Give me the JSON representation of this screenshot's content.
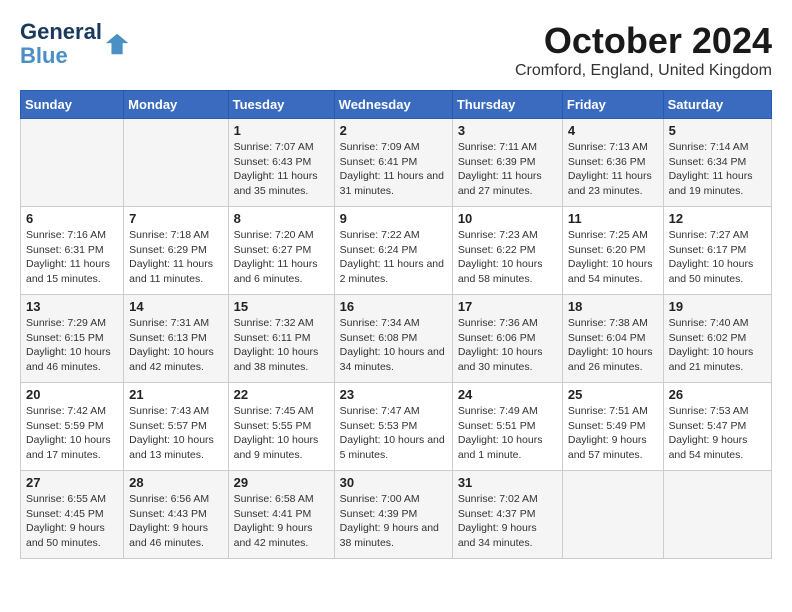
{
  "logo": {
    "line1": "General",
    "line2": "Blue"
  },
  "title": "October 2024",
  "location": "Cromford, England, United Kingdom",
  "days_header": [
    "Sunday",
    "Monday",
    "Tuesday",
    "Wednesday",
    "Thursday",
    "Friday",
    "Saturday"
  ],
  "weeks": [
    [
      {
        "day": "",
        "info": ""
      },
      {
        "day": "",
        "info": ""
      },
      {
        "day": "1",
        "info": "Sunrise: 7:07 AM\nSunset: 6:43 PM\nDaylight: 11 hours and 35 minutes."
      },
      {
        "day": "2",
        "info": "Sunrise: 7:09 AM\nSunset: 6:41 PM\nDaylight: 11 hours and 31 minutes."
      },
      {
        "day": "3",
        "info": "Sunrise: 7:11 AM\nSunset: 6:39 PM\nDaylight: 11 hours and 27 minutes."
      },
      {
        "day": "4",
        "info": "Sunrise: 7:13 AM\nSunset: 6:36 PM\nDaylight: 11 hours and 23 minutes."
      },
      {
        "day": "5",
        "info": "Sunrise: 7:14 AM\nSunset: 6:34 PM\nDaylight: 11 hours and 19 minutes."
      }
    ],
    [
      {
        "day": "6",
        "info": "Sunrise: 7:16 AM\nSunset: 6:31 PM\nDaylight: 11 hours and 15 minutes."
      },
      {
        "day": "7",
        "info": "Sunrise: 7:18 AM\nSunset: 6:29 PM\nDaylight: 11 hours and 11 minutes."
      },
      {
        "day": "8",
        "info": "Sunrise: 7:20 AM\nSunset: 6:27 PM\nDaylight: 11 hours and 6 minutes."
      },
      {
        "day": "9",
        "info": "Sunrise: 7:22 AM\nSunset: 6:24 PM\nDaylight: 11 hours and 2 minutes."
      },
      {
        "day": "10",
        "info": "Sunrise: 7:23 AM\nSunset: 6:22 PM\nDaylight: 10 hours and 58 minutes."
      },
      {
        "day": "11",
        "info": "Sunrise: 7:25 AM\nSunset: 6:20 PM\nDaylight: 10 hours and 54 minutes."
      },
      {
        "day": "12",
        "info": "Sunrise: 7:27 AM\nSunset: 6:17 PM\nDaylight: 10 hours and 50 minutes."
      }
    ],
    [
      {
        "day": "13",
        "info": "Sunrise: 7:29 AM\nSunset: 6:15 PM\nDaylight: 10 hours and 46 minutes."
      },
      {
        "day": "14",
        "info": "Sunrise: 7:31 AM\nSunset: 6:13 PM\nDaylight: 10 hours and 42 minutes."
      },
      {
        "day": "15",
        "info": "Sunrise: 7:32 AM\nSunset: 6:11 PM\nDaylight: 10 hours and 38 minutes."
      },
      {
        "day": "16",
        "info": "Sunrise: 7:34 AM\nSunset: 6:08 PM\nDaylight: 10 hours and 34 minutes."
      },
      {
        "day": "17",
        "info": "Sunrise: 7:36 AM\nSunset: 6:06 PM\nDaylight: 10 hours and 30 minutes."
      },
      {
        "day": "18",
        "info": "Sunrise: 7:38 AM\nSunset: 6:04 PM\nDaylight: 10 hours and 26 minutes."
      },
      {
        "day": "19",
        "info": "Sunrise: 7:40 AM\nSunset: 6:02 PM\nDaylight: 10 hours and 21 minutes."
      }
    ],
    [
      {
        "day": "20",
        "info": "Sunrise: 7:42 AM\nSunset: 5:59 PM\nDaylight: 10 hours and 17 minutes."
      },
      {
        "day": "21",
        "info": "Sunrise: 7:43 AM\nSunset: 5:57 PM\nDaylight: 10 hours and 13 minutes."
      },
      {
        "day": "22",
        "info": "Sunrise: 7:45 AM\nSunset: 5:55 PM\nDaylight: 10 hours and 9 minutes."
      },
      {
        "day": "23",
        "info": "Sunrise: 7:47 AM\nSunset: 5:53 PM\nDaylight: 10 hours and 5 minutes."
      },
      {
        "day": "24",
        "info": "Sunrise: 7:49 AM\nSunset: 5:51 PM\nDaylight: 10 hours and 1 minute."
      },
      {
        "day": "25",
        "info": "Sunrise: 7:51 AM\nSunset: 5:49 PM\nDaylight: 9 hours and 57 minutes."
      },
      {
        "day": "26",
        "info": "Sunrise: 7:53 AM\nSunset: 5:47 PM\nDaylight: 9 hours and 54 minutes."
      }
    ],
    [
      {
        "day": "27",
        "info": "Sunrise: 6:55 AM\nSunset: 4:45 PM\nDaylight: 9 hours and 50 minutes."
      },
      {
        "day": "28",
        "info": "Sunrise: 6:56 AM\nSunset: 4:43 PM\nDaylight: 9 hours and 46 minutes."
      },
      {
        "day": "29",
        "info": "Sunrise: 6:58 AM\nSunset: 4:41 PM\nDaylight: 9 hours and 42 minutes."
      },
      {
        "day": "30",
        "info": "Sunrise: 7:00 AM\nSunset: 4:39 PM\nDaylight: 9 hours and 38 minutes."
      },
      {
        "day": "31",
        "info": "Sunrise: 7:02 AM\nSunset: 4:37 PM\nDaylight: 9 hours and 34 minutes."
      },
      {
        "day": "",
        "info": ""
      },
      {
        "day": "",
        "info": ""
      }
    ]
  ]
}
